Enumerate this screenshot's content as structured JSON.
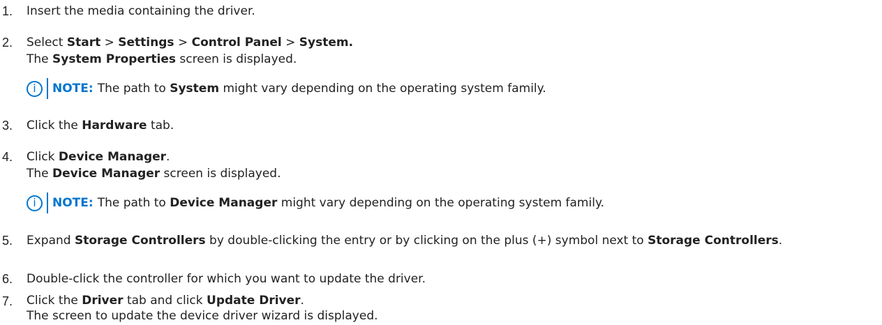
{
  "steps": [
    {
      "number": "1.",
      "parts": [
        "Insert the media containing the driver."
      ]
    },
    {
      "number": "2.",
      "parts": [
        "Select ",
        "Start",
        " > ",
        "Settings",
        " > ",
        "Control Panel",
        " > ",
        "System."
      ],
      "sub_parts": [
        "The ",
        "System Properties",
        " screen is displayed."
      ],
      "note": {
        "label": "NOTE:",
        "parts": [
          "The path to ",
          "System",
          " might vary depending on the operating system family."
        ]
      }
    },
    {
      "number": "3.",
      "parts": [
        "Click the ",
        "Hardware",
        " tab."
      ]
    },
    {
      "number": "4.",
      "parts": [
        "Click ",
        "Device Manager",
        "."
      ],
      "sub_parts": [
        "The ",
        "Device Manager",
        " screen is displayed."
      ],
      "note": {
        "label": "NOTE:",
        "parts": [
          "The path to ",
          "Device Manager",
          " might vary depending on the operating system family."
        ]
      }
    },
    {
      "number": "5.",
      "parts": [
        "Expand ",
        "Storage Controllers",
        " by double-clicking the entry or by clicking on the plus (+) symbol next to ",
        "Storage Controllers",
        "."
      ]
    },
    {
      "number": "6.",
      "parts": [
        "Double-click the controller for which you want to update the driver."
      ]
    },
    {
      "number": "7.",
      "parts": [
        "Click the ",
        "Driver",
        " tab and click ",
        "Update Driver",
        "."
      ],
      "sub_parts": [
        "The screen to update the device driver wizard is displayed."
      ]
    }
  ],
  "colors": {
    "accent": "#0076ce",
    "text": "#222222"
  },
  "icons": {
    "note": "info-icon",
    "note_glyph": "i"
  }
}
